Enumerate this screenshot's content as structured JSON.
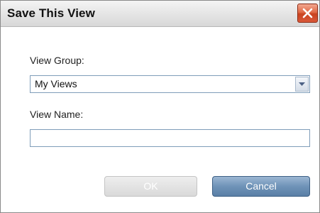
{
  "dialog": {
    "title": "Save This View",
    "close_icon": "close-icon"
  },
  "form": {
    "view_group_label": "View Group:",
    "view_group_selected": "My Views",
    "dropdown_icon": "chevron-down-icon",
    "view_name_label": "View Name:",
    "view_name_value": ""
  },
  "buttons": {
    "ok_label": "OK",
    "ok_enabled": false,
    "cancel_label": "Cancel"
  },
  "colors": {
    "close_button": "#d9593a",
    "cancel_button": "#6f93b8",
    "input_border": "#7f9db9"
  }
}
